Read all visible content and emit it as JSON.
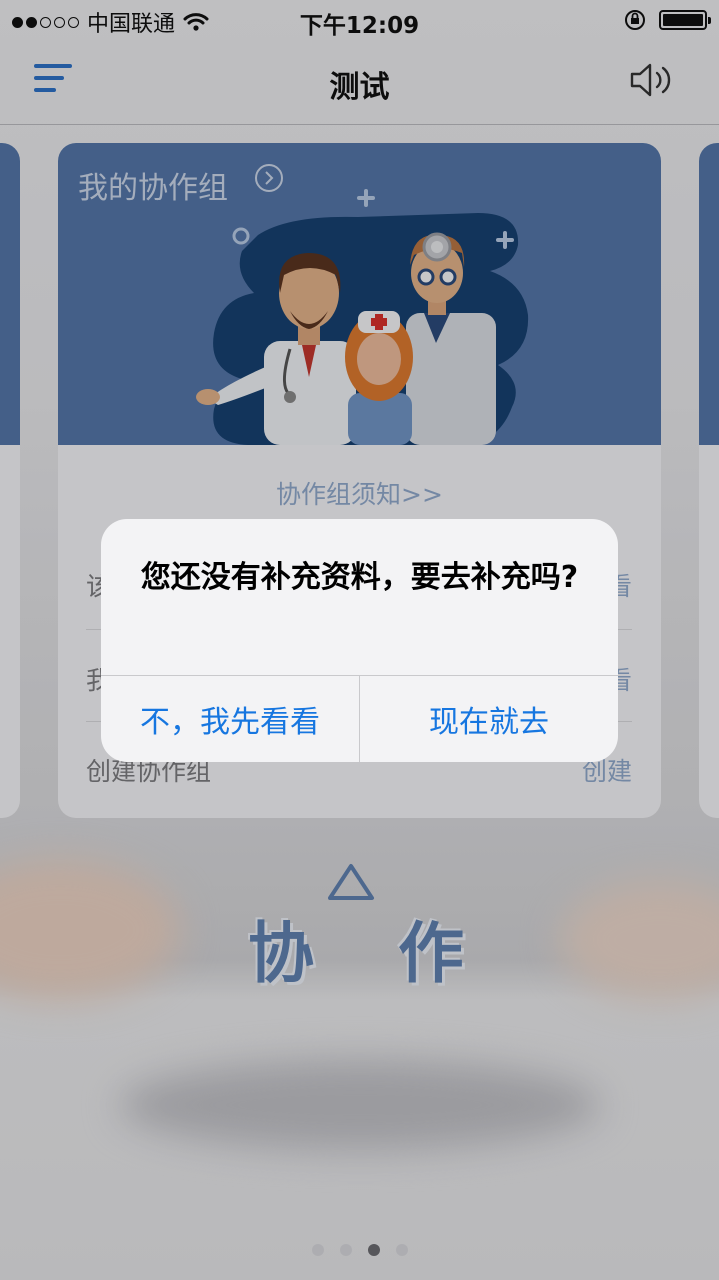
{
  "status_bar": {
    "carrier": "中国联通",
    "time": "下午12:09"
  },
  "nav": {
    "title": "测试",
    "menu_icon": "menu-icon",
    "speaker_icon": "speaker-icon"
  },
  "card": {
    "title": "我的协作组",
    "notice_link": "协作组须知>>",
    "rows": [
      {
        "label": "该",
        "action": "看"
      },
      {
        "label": "我",
        "action": "看"
      },
      {
        "label": "创建协作组",
        "action": "创建"
      }
    ]
  },
  "decoration": {
    "char1": "协",
    "char2": "作"
  },
  "alert": {
    "message": "您还没有补充资料，要去补充吗?",
    "cancel_label": "不，我先看看",
    "confirm_label": "现在就去"
  },
  "colors": {
    "accent": "#1676e0",
    "banner": "#5475a6",
    "link": "#8ea6c8"
  }
}
